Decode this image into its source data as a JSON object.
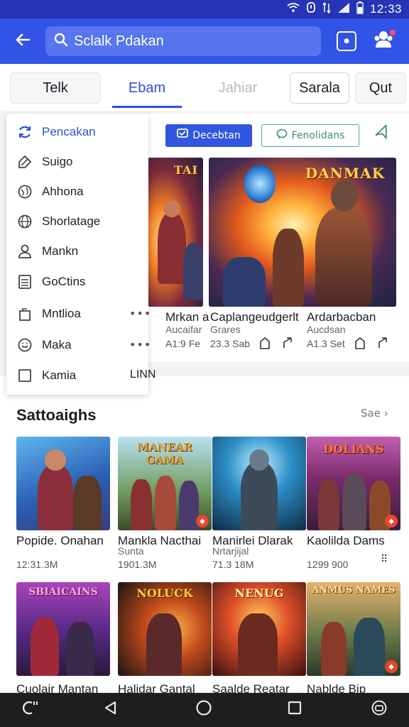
{
  "status_bar": {
    "time": "12:33"
  },
  "app_bar": {
    "search_text": "Sclalk Pdakan"
  },
  "tabs": [
    {
      "label": "Telk"
    },
    {
      "label": "Ebam"
    },
    {
      "label": "Jahiar"
    },
    {
      "label": "Sarala"
    },
    {
      "label": "Qut"
    }
  ],
  "filter_chips": {
    "primary": "Decebtan",
    "secondary": "Fenolidans"
  },
  "featured": [
    {
      "title": "Mrkan a",
      "subtitle": "Aucaifar",
      "meta": "A1:9 Fe"
    },
    {
      "title": "Caplangeudgerlt",
      "subtitle": "Grares",
      "meta": "23.3 Sab",
      "art_title": ""
    },
    {
      "title": "Ardarbacban",
      "subtitle": "Aucdsan",
      "meta": "A1.3 Set",
      "art_title": "DANMAK"
    }
  ],
  "menu": {
    "items": [
      {
        "label": "Pencakan",
        "icon": "sync-icon"
      },
      {
        "label": "Suigo",
        "icon": "tag-icon"
      },
      {
        "label": "Ahhona",
        "icon": "globe-icon"
      },
      {
        "label": "Shorlatage",
        "icon": "world-icon"
      },
      {
        "label": "Mankn",
        "icon": "person-icon"
      },
      {
        "label": "GoCtins",
        "icon": "list-icon"
      },
      {
        "label": "Mntlioa",
        "icon": "bag-icon"
      },
      {
        "label": "Maka",
        "icon": "smile-icon"
      },
      {
        "label": "Kamia",
        "icon": "checkbox-icon"
      }
    ],
    "trailing_text": "LINN"
  },
  "section": {
    "title": "Sattoaighs",
    "see_label": "Sae"
  },
  "games": [
    {
      "title": "Popide. Onahan",
      "subtitle": "",
      "meta": "12:31.3M",
      "art_title": ""
    },
    {
      "title": "Mankla Nacthai",
      "subtitle": "Sunta",
      "meta": "1901.3M",
      "art_title": "MANEAR GAMA"
    },
    {
      "title": "Manirlei Dlarak",
      "subtitle": "Nrtarjijal",
      "meta": "71.3 18M",
      "art_title": ""
    },
    {
      "title": "Kaolilda Dams",
      "subtitle": "",
      "meta": "1299 900",
      "art_title": "DOLIANS"
    },
    {
      "title": "Cuolair Mantan",
      "art_title": "SBIAICAINS"
    },
    {
      "title": "Halidar Gantal",
      "art_title": "NOLUCK"
    },
    {
      "title": "Saalde Reatar",
      "art_title": "NENUG"
    },
    {
      "title": "Nablde Bip",
      "art_title": "ANMUS NAMES"
    }
  ]
}
